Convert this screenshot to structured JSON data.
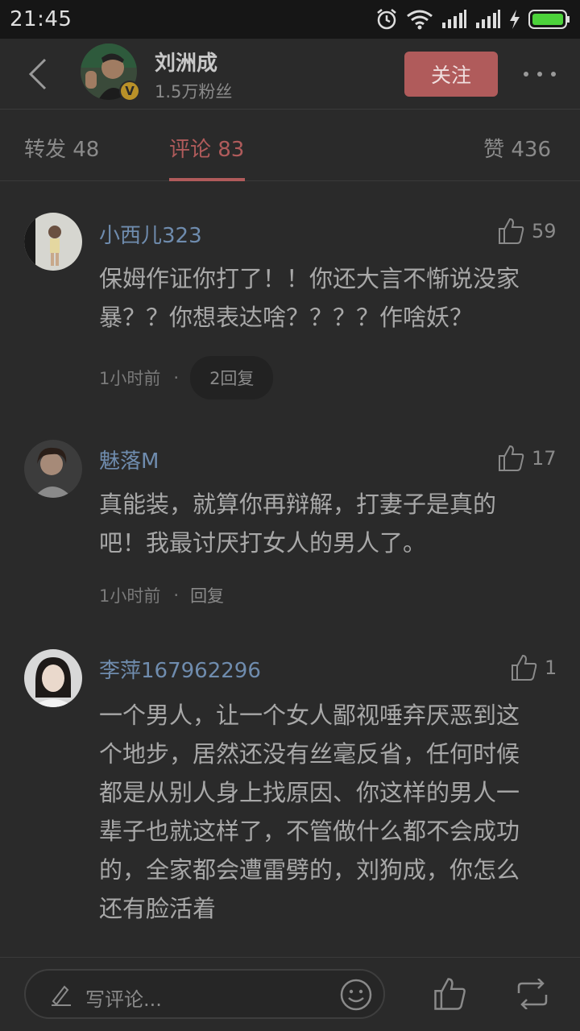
{
  "status_bar": {
    "time": "21:45"
  },
  "header": {
    "user_name": "刘洲成",
    "fans": "1.5万粉丝",
    "follow_label": "关注",
    "verified_badge": "V"
  },
  "tabs": [
    {
      "label": "转发 48"
    },
    {
      "label": "评论 83"
    },
    {
      "label": "赞 436"
    }
  ],
  "comments": [
    {
      "name": "小西儿323",
      "likes": "59",
      "text_lines": [
        "保姆作证你打了！！你还大言不惭说没家",
        "暴？？你想表达啥？？？？作啥妖？"
      ],
      "time": "1小时前",
      "dot": "·",
      "reply": "2回复"
    },
    {
      "name": "魅落M",
      "likes": "17",
      "text_lines": [
        "真能装，就算你再辩解，打妻子是真的",
        "吧！我最讨厌打女人的男人了。"
      ],
      "time": "1小时前",
      "dot": "·",
      "reply": "回复"
    },
    {
      "name": "李萍167962296",
      "likes": "1",
      "text_lines": [
        "一个男人，让一个女人鄙视唾弃厌恶到这",
        "个地步，居然还没有丝毫反省，任何时候",
        "都是从别人身上找原因、你这样的男人一",
        "辈子也就这样了，不管做什么都不会成功",
        "的，全家都会遭雷劈的，刘狗成，你怎么",
        "还有脸活着"
      ]
    }
  ],
  "bottom_bar": {
    "placeholder": "写评论..."
  }
}
